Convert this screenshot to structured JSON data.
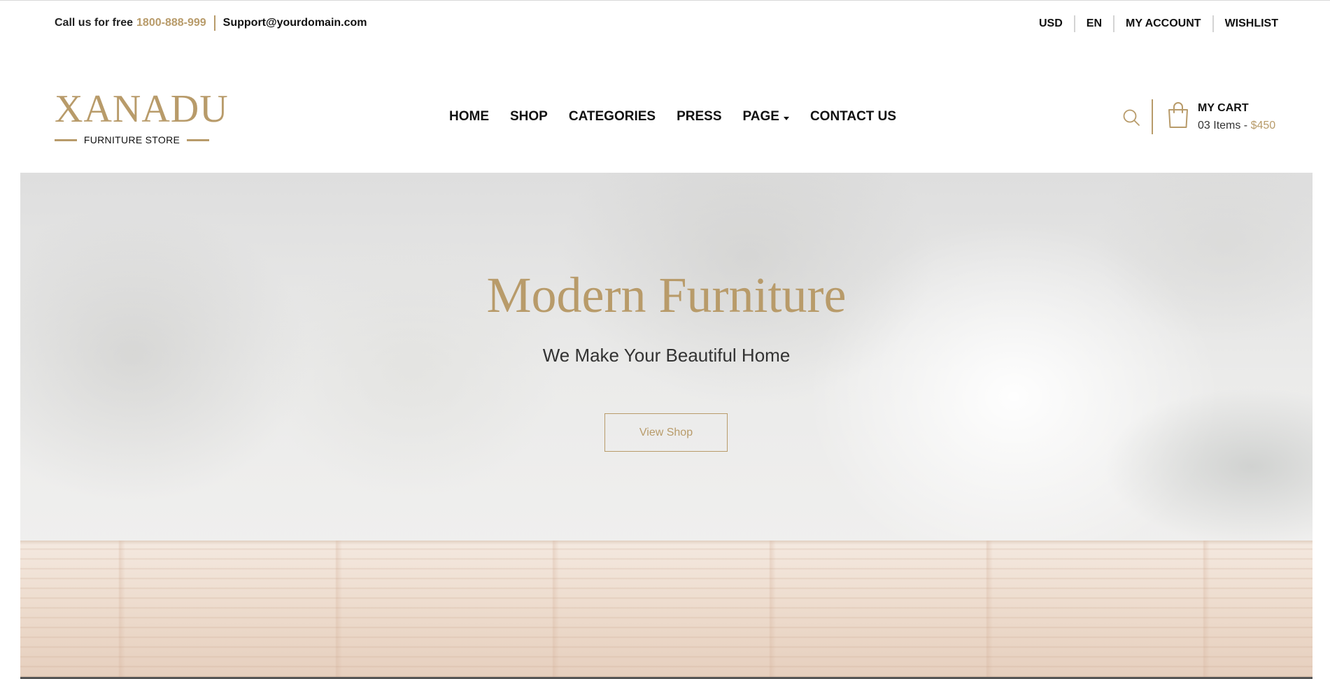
{
  "topbar": {
    "call_text": "Call us for free",
    "phone": "1800-888-999",
    "email": "Support@yourdomain.com",
    "links": [
      "USD",
      "EN",
      "MY ACCOUNT",
      "WISHLIST"
    ]
  },
  "logo": {
    "title": "XANADU",
    "subtitle": "FURNITURE STORE"
  },
  "nav": {
    "items": [
      "HOME",
      "SHOP",
      "CATEGORIES",
      "PRESS",
      "PAGE",
      "CONTACT US"
    ]
  },
  "cart": {
    "title": "MY CART",
    "items": "03 Items - ",
    "price": "$450"
  },
  "hero": {
    "title": "Modern Furniture",
    "subtitle": "We Make Your Beautiful Home",
    "button": "View Shop"
  },
  "colors": {
    "accent": "#b89b6a",
    "text": "#111111"
  },
  "icons": [
    "search-icon",
    "shopping-bag-icon",
    "caret-down-icon"
  ]
}
